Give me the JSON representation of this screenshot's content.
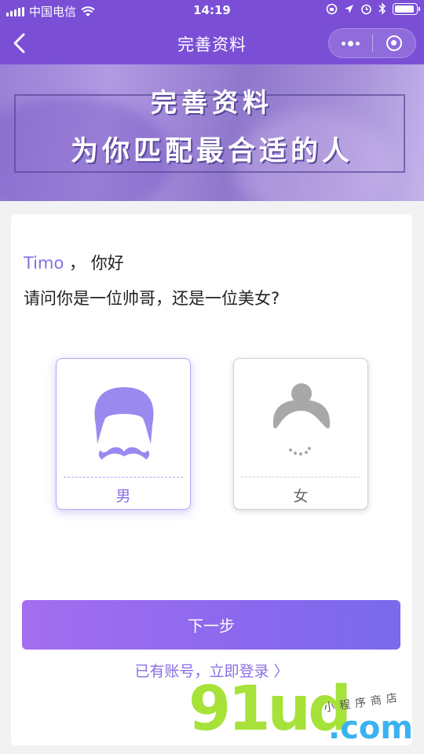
{
  "status_bar": {
    "carrier": "中国电信",
    "time": "14:19"
  },
  "nav": {
    "title": "完善资料"
  },
  "banner": {
    "line1": "完善资料",
    "line2": "为你匹配最合适的人"
  },
  "greeting": {
    "name": "Timo",
    "separator": "，",
    "hello": "你好",
    "question": "请问你是一位帅哥，还是一位美女?"
  },
  "options": {
    "male_label": "男",
    "female_label": "女",
    "selected": "男"
  },
  "actions": {
    "next_label": "下一步",
    "login_link": "已有账号，立即登录 〉"
  },
  "watermark": {
    "brand": "91ud",
    "domain": ".com",
    "tagline": "小程序商店"
  },
  "colors": {
    "accent": "#7a4fd6",
    "accent_light": "#8a6ee6",
    "male_icon": "#9a8af0",
    "female_icon": "#a8a8a8"
  },
  "icons": {
    "back": "chevron-left-icon",
    "more": "more-dots-icon",
    "close": "target-circle-icon",
    "wifi": "wifi-icon",
    "signal": "signal-bars-icon",
    "battery": "battery-icon",
    "alarm": "alarm-icon",
    "location": "location-arrow-icon",
    "bluetooth": "bluetooth-icon",
    "lock_rotation": "rotation-lock-icon"
  }
}
